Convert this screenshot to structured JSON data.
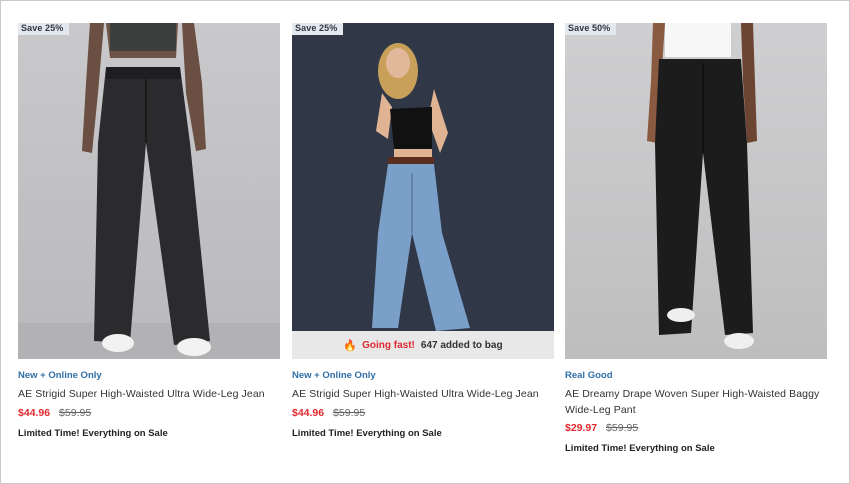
{
  "products": [
    {
      "badge": "Save 25%",
      "tag": "New + Online Only",
      "title": "AE Strigid Super High-Waisted Ultra Wide-Leg Jean",
      "sale_price": "$44.96",
      "original_price": "$59.95",
      "promo": "Limited Time! Everything on Sale"
    },
    {
      "badge": "Save 25%",
      "tag": "New + Online Only",
      "title": "AE Strigid Super High-Waisted Ultra Wide-Leg Jean",
      "sale_price": "$44.96",
      "original_price": "$59.95",
      "promo": "Limited Time! Everything on Sale",
      "going_fast": {
        "label": "Going fast!",
        "count": "647 added to bag",
        "icon": "fire-icon"
      }
    },
    {
      "badge": "Save 50%",
      "tag": "Real Good",
      "title": "AE Dreamy Drape Woven Super High-Waisted Baggy Wide-Leg Pant",
      "sale_price": "$29.97",
      "original_price": "$59.95",
      "promo": "Limited Time! Everything on Sale"
    }
  ],
  "colors": {
    "sale_price": "#e0282e",
    "tag": "#2f6fa6",
    "badge_bg": "#e3e8ef"
  }
}
